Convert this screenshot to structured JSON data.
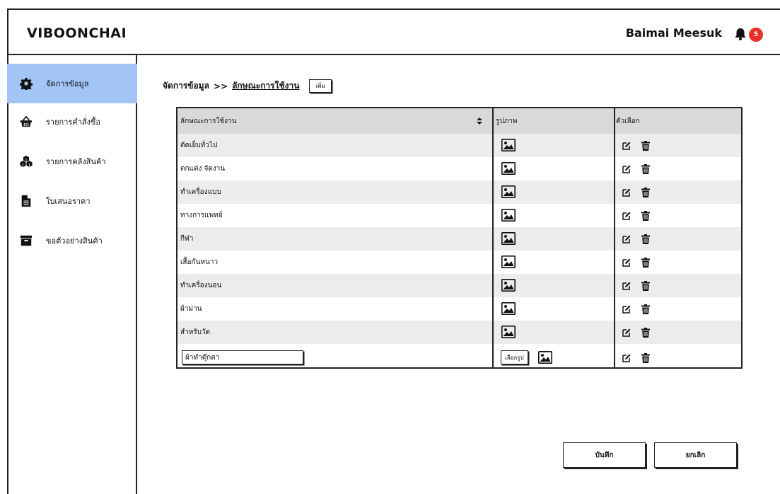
{
  "app": {
    "logo": "VIBOONCHAI"
  },
  "header": {
    "user_name": "Baimai Meesuk",
    "notification_count": "5"
  },
  "sidebar": {
    "items": [
      {
        "label": "จัดการข้อมูล",
        "icon": "gear-icon",
        "active": true
      },
      {
        "label": "รายการคำสั่งซื้อ",
        "icon": "basket-icon",
        "active": false
      },
      {
        "label": "รายการคลังสินค้า",
        "icon": "boxes-icon",
        "active": false
      },
      {
        "label": "ใบเสนอราคา",
        "icon": "document-icon",
        "active": false
      },
      {
        "label": "ขอตัวอย่างสินค้า",
        "icon": "archive-icon",
        "active": false
      }
    ]
  },
  "breadcrumb": {
    "root": "จัดการข้อมูล",
    "separator": ">>",
    "current": "ลักษณะการใช้งาน",
    "add_label": "เพิ่ม"
  },
  "table": {
    "columns": {
      "name": "ลักษณะการใช้งาน",
      "image": "รูปภาพ",
      "options": "ตัวเลือก"
    },
    "rows": [
      {
        "name": "ตัดเย็บทั่วไป"
      },
      {
        "name": "ตกแต่ง จัดงาน"
      },
      {
        "name": "ทำเครื่องแบบ"
      },
      {
        "name": "ทางการแพทย์"
      },
      {
        "name": "กีฬา"
      },
      {
        "name": "เสื้อกันหนาว"
      },
      {
        "name": "ทำเครื่องนอน"
      },
      {
        "name": "ผ้าม่าน"
      },
      {
        "name": "สำหรับวัด"
      }
    ],
    "new_row": {
      "input_value": "ผ้าทำตุ๊กตา",
      "choose_image_label": "เลือกรูป"
    }
  },
  "actions": {
    "save_label": "บันทึก",
    "cancel_label": "ยกเลิก"
  },
  "colors": {
    "active_sidebar": "#a3c5f6",
    "badge": "#e8322b",
    "header_row": "#d9d9d9",
    "alt_row": "#ececec"
  }
}
